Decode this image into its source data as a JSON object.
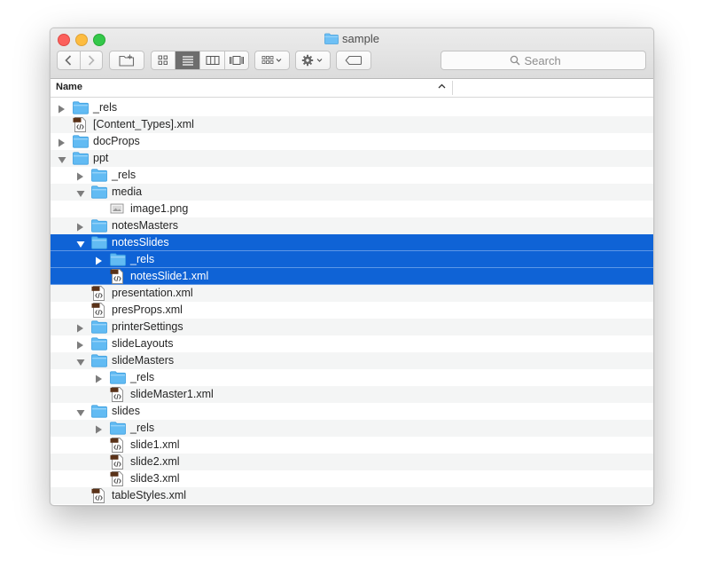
{
  "window": {
    "title": "sample"
  },
  "search": {
    "placeholder": "Search"
  },
  "header": {
    "name_column": "Name"
  },
  "colors": {
    "selection": "#0f63d6",
    "folder": "#5ab4ef",
    "alt_row": "#f4f5f5"
  },
  "rows": [
    {
      "label": "_rels",
      "depth": 0,
      "kind": "folder",
      "disclosure": "collapsed",
      "selected": false
    },
    {
      "label": "[Content_Types].xml",
      "depth": 0,
      "kind": "xml-file",
      "disclosure": "none",
      "selected": false
    },
    {
      "label": "docProps",
      "depth": 0,
      "kind": "folder",
      "disclosure": "collapsed",
      "selected": false
    },
    {
      "label": "ppt",
      "depth": 0,
      "kind": "folder",
      "disclosure": "expanded",
      "selected": false
    },
    {
      "label": "_rels",
      "depth": 1,
      "kind": "folder",
      "disclosure": "collapsed",
      "selected": false
    },
    {
      "label": "media",
      "depth": 1,
      "kind": "folder",
      "disclosure": "expanded",
      "selected": false
    },
    {
      "label": "image1.png",
      "depth": 2,
      "kind": "image-file",
      "disclosure": "none",
      "selected": false
    },
    {
      "label": "notesMasters",
      "depth": 1,
      "kind": "folder",
      "disclosure": "collapsed",
      "selected": false
    },
    {
      "label": "notesSlides",
      "depth": 1,
      "kind": "folder",
      "disclosure": "expanded",
      "selected": true
    },
    {
      "label": "_rels",
      "depth": 2,
      "kind": "folder",
      "disclosure": "collapsed",
      "selected": true
    },
    {
      "label": "notesSlide1.xml",
      "depth": 2,
      "kind": "xml-file",
      "disclosure": "none",
      "selected": true
    },
    {
      "label": "presentation.xml",
      "depth": 1,
      "kind": "xml-file",
      "disclosure": "none",
      "selected": false
    },
    {
      "label": "presProps.xml",
      "depth": 1,
      "kind": "xml-file",
      "disclosure": "none",
      "selected": false
    },
    {
      "label": "printerSettings",
      "depth": 1,
      "kind": "folder",
      "disclosure": "collapsed",
      "selected": false
    },
    {
      "label": "slideLayouts",
      "depth": 1,
      "kind": "folder",
      "disclosure": "collapsed",
      "selected": false
    },
    {
      "label": "slideMasters",
      "depth": 1,
      "kind": "folder",
      "disclosure": "expanded",
      "selected": false
    },
    {
      "label": "_rels",
      "depth": 2,
      "kind": "folder",
      "disclosure": "collapsed",
      "selected": false
    },
    {
      "label": "slideMaster1.xml",
      "depth": 2,
      "kind": "xml-file",
      "disclosure": "none",
      "selected": false
    },
    {
      "label": "slides",
      "depth": 1,
      "kind": "folder",
      "disclosure": "expanded",
      "selected": false
    },
    {
      "label": "_rels",
      "depth": 2,
      "kind": "folder",
      "disclosure": "collapsed",
      "selected": false
    },
    {
      "label": "slide1.xml",
      "depth": 2,
      "kind": "xml-file",
      "disclosure": "none",
      "selected": false
    },
    {
      "label": "slide2.xml",
      "depth": 2,
      "kind": "xml-file",
      "disclosure": "none",
      "selected": false
    },
    {
      "label": "slide3.xml",
      "depth": 2,
      "kind": "xml-file",
      "disclosure": "none",
      "selected": false
    },
    {
      "label": "tableStyles.xml",
      "depth": 1,
      "kind": "xml-file",
      "disclosure": "none",
      "selected": false
    }
  ]
}
